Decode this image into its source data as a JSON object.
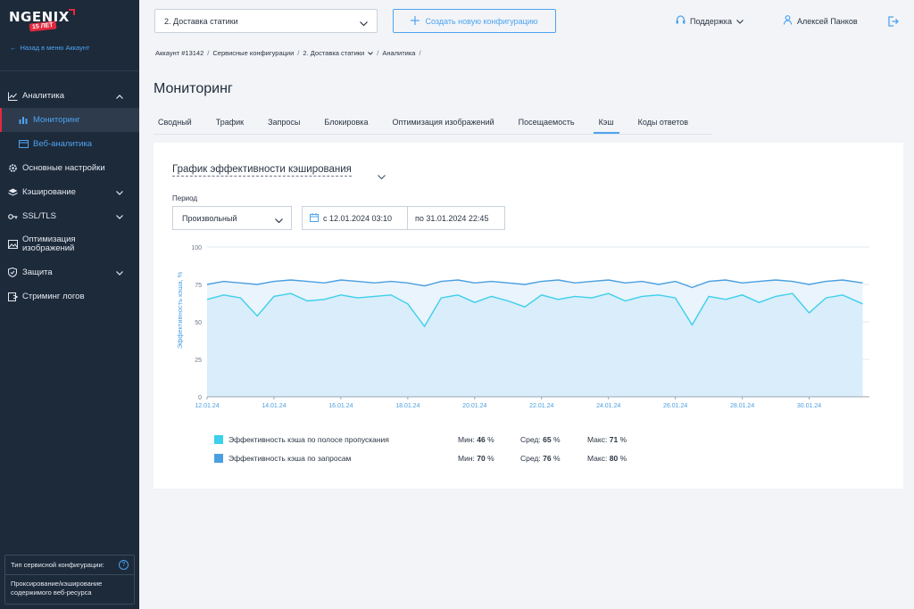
{
  "sidebar": {
    "logo": "NGENIX",
    "logo_badge": "15 ЛЕТ",
    "back_label": "Назад в меню Аккаунт",
    "items": [
      {
        "label": "Аналитика"
      },
      {
        "label": "Мониторинг"
      },
      {
        "label": "Веб-аналитика"
      },
      {
        "label": "Основные настройки"
      },
      {
        "label": "Кэширование"
      },
      {
        "label": "SSL/TLS"
      },
      {
        "label": "Оптимизация изображений"
      },
      {
        "label": "Защита"
      },
      {
        "label": "Стриминг логов"
      }
    ],
    "config_type_label": "Тип сервисной конфигурации:",
    "config_type_help": "?",
    "config_type_value": "Проксирование/кэширование содержимого веб-ресурса"
  },
  "header": {
    "config_select": "2. Доставка статики",
    "create_button": "Создать новую конфигурацию",
    "support": "Поддержка",
    "user": "Алексей Панков"
  },
  "breadcrumbs": [
    "Аккаунт #13142",
    "Сервисные конфигурации",
    "2. Доставка статики",
    "Аналитика"
  ],
  "page_title": "Мониторинг",
  "tabs": [
    "Сводный",
    "Трафик",
    "Запросы",
    "Блокировка",
    "Оптимизация изображений",
    "Посещаемость",
    "Кэш",
    "Коды ответов"
  ],
  "active_tab": "Кэш",
  "card": {
    "title": "График эффективности кэширования",
    "period_label": "Период",
    "period_value": "Произвольный",
    "date_from": "с 12.01.2024 03:10",
    "date_to": "по 31.01.2024 22:45"
  },
  "chart_data": {
    "type": "area",
    "ylabel": "Эффективность кэша, %",
    "ylim": [
      0,
      100
    ],
    "yticks": [
      "0",
      "25",
      "50",
      "75",
      "100"
    ],
    "x_tick_labels": [
      "12.01.24",
      "14.01.24",
      "16.01.24",
      "18.01.24",
      "20.01.24",
      "22.01.24",
      "24.01.24",
      "26.01.24",
      "28.01.24",
      "30.01.24"
    ],
    "x_days": [
      0,
      2,
      4,
      6,
      8,
      10,
      12,
      14,
      16,
      18
    ],
    "grid": true,
    "series": [
      {
        "name": "Эффективность кэша по полосе пропускания",
        "color": "#3dd0ea",
        "x_days": [
          0,
          0.5,
          1,
          1.5,
          2,
          2.5,
          3,
          3.5,
          4,
          4.5,
          5,
          5.5,
          6,
          6.5,
          7,
          7.5,
          8,
          8.5,
          9,
          9.5,
          10,
          10.5,
          11,
          11.5,
          12,
          12.5,
          13,
          13.5,
          14,
          14.5,
          15,
          15.5,
          16,
          16.5,
          17,
          17.5,
          18,
          18.5,
          19,
          19.6
        ],
        "values": [
          65,
          68,
          66,
          54,
          67,
          69,
          64,
          65,
          68,
          66,
          67,
          68,
          62,
          47,
          66,
          68,
          63,
          67,
          64,
          60,
          68,
          65,
          67,
          66,
          69,
          64,
          67,
          68,
          66,
          48,
          67,
          65,
          68,
          63,
          67,
          69,
          56,
          66,
          68,
          62
        ],
        "min": "46",
        "avg": "65",
        "max": "71"
      },
      {
        "name": "Эффективность кэша по запросам",
        "color": "#4a9fe0",
        "x_days": [
          0,
          0.5,
          1,
          1.5,
          2,
          2.5,
          3,
          3.5,
          4,
          4.5,
          5,
          5.5,
          6,
          6.5,
          7,
          7.5,
          8,
          8.5,
          9,
          9.5,
          10,
          10.5,
          11,
          11.5,
          12,
          12.5,
          13,
          13.5,
          14,
          14.5,
          15,
          15.5,
          16,
          16.5,
          17,
          17.5,
          18,
          18.5,
          19,
          19.6
        ],
        "values": [
          75,
          77,
          76,
          75,
          77,
          78,
          77,
          76,
          78,
          77,
          76,
          77,
          76,
          74,
          77,
          78,
          76,
          77,
          76,
          75,
          77,
          78,
          76,
          77,
          78,
          76,
          77,
          75,
          77,
          73,
          77,
          78,
          76,
          77,
          78,
          77,
          75,
          77,
          78,
          76
        ],
        "min": "70",
        "avg": "76",
        "max": "80"
      }
    ]
  },
  "legend": {
    "min_label": "Мин:",
    "avg_label": "Сред:",
    "max_label": "Макс:",
    "unit": "%"
  }
}
